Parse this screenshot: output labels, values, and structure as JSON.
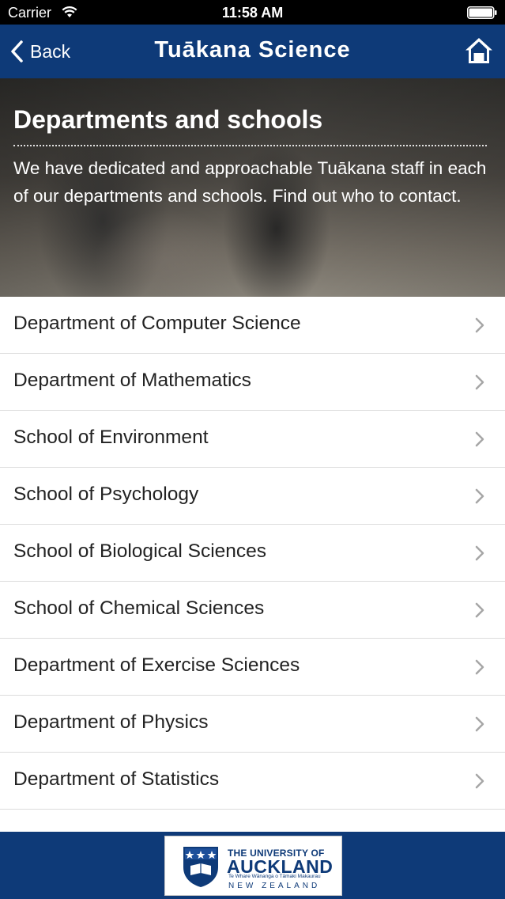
{
  "status_bar": {
    "carrier": "Carrier",
    "time": "11:58 AM"
  },
  "nav": {
    "back_label": "Back",
    "title": "Tuākana Science"
  },
  "hero": {
    "title": "Departments and schools",
    "description": "We have dedicated and approachable Tuākana staff in each of our departments and schools. Find out who to contact."
  },
  "departments": [
    {
      "label": "Department of Computer Science"
    },
    {
      "label": "Department of Mathematics"
    },
    {
      "label": "School of Environment"
    },
    {
      "label": "School of Psychology"
    },
    {
      "label": "School of Biological Sciences"
    },
    {
      "label": "School of Chemical Sciences"
    },
    {
      "label": "Department of Exercise Sciences"
    },
    {
      "label": "Department of Physics"
    },
    {
      "label": "Department of Statistics"
    }
  ],
  "footer": {
    "logo_line1": "THE UNIVERSITY OF",
    "logo_line2": "AUCKLAND",
    "logo_line3": "Te Whare Wānanga o Tāmaki Makaurau",
    "logo_line4": "NEW ZEALAND"
  },
  "colors": {
    "navy": "#0e3a78",
    "text": "#222222",
    "divider": "#dcdcdc",
    "chevron": "#a6a6a6"
  },
  "icons": {
    "back": "chevron-left-icon",
    "home": "home-icon",
    "row": "chevron-right-icon",
    "wifi": "wifi-icon",
    "battery": "battery-icon"
  }
}
